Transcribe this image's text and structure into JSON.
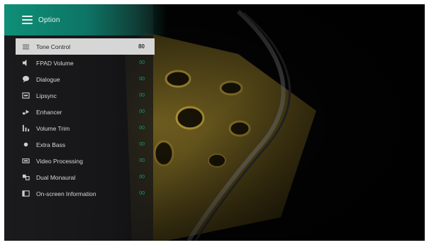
{
  "header": {
    "title": "Option"
  },
  "menu": {
    "items": [
      {
        "label": "Tone Control",
        "value": "80",
        "icon": "equalizer-icon"
      },
      {
        "label": "FPAD Volume",
        "value": "00",
        "icon": "speaker-icon"
      },
      {
        "label": "Dialogue",
        "value": "00",
        "icon": "speech-bubble-icon"
      },
      {
        "label": "Lipsync",
        "value": "00",
        "icon": "lipsync-icon"
      },
      {
        "label": "Enhancer",
        "value": "00",
        "icon": "enhancer-icon"
      },
      {
        "label": "Volume Trim",
        "value": "00",
        "icon": "volume-trim-icon"
      },
      {
        "label": "Extra Bass",
        "value": "00",
        "icon": "bass-icon"
      },
      {
        "label": "Video Processing",
        "value": "00",
        "icon": "video-icon"
      },
      {
        "label": "Dual Monaural",
        "value": "00",
        "icon": "dual-mono-icon"
      },
      {
        "label": "On-screen Information",
        "value": "00",
        "icon": "screen-info-icon"
      }
    ]
  },
  "colors": {
    "header": "#0f8f78",
    "selected": "#d6d6d6",
    "value": "#1a9a7a"
  }
}
